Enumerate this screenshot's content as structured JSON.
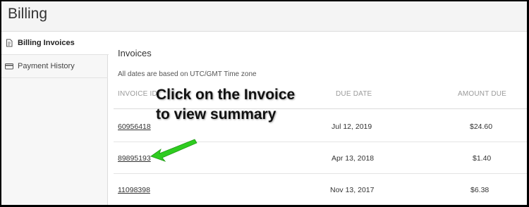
{
  "header": {
    "title": "Billing"
  },
  "sidebar": {
    "items": [
      {
        "label": "Billing Invoices",
        "icon": "document-icon",
        "active": true
      },
      {
        "label": "Payment History",
        "icon": "credit-card-icon",
        "active": false
      }
    ]
  },
  "main": {
    "section_title": "Invoices",
    "timezone_note": "All dates are based on UTC/GMT Time zone",
    "columns": {
      "invoice_id": "INVOICE ID",
      "due_date": "DUE DATE",
      "amount_due": "AMOUNT DUE"
    },
    "rows": [
      {
        "invoice_id": "60956418",
        "due_date": "Jul 12, 2019",
        "amount": "$24.60"
      },
      {
        "invoice_id": "89895193",
        "due_date": "Apr 13, 2018",
        "amount": "$1.40"
      },
      {
        "invoice_id": "11098398",
        "due_date": "Nov 13, 2017",
        "amount": "$6.38"
      }
    ]
  },
  "annotation": {
    "line1": "Click on the Invoice",
    "line2": "to view summary",
    "arrow_color": "#2ecc1f"
  }
}
